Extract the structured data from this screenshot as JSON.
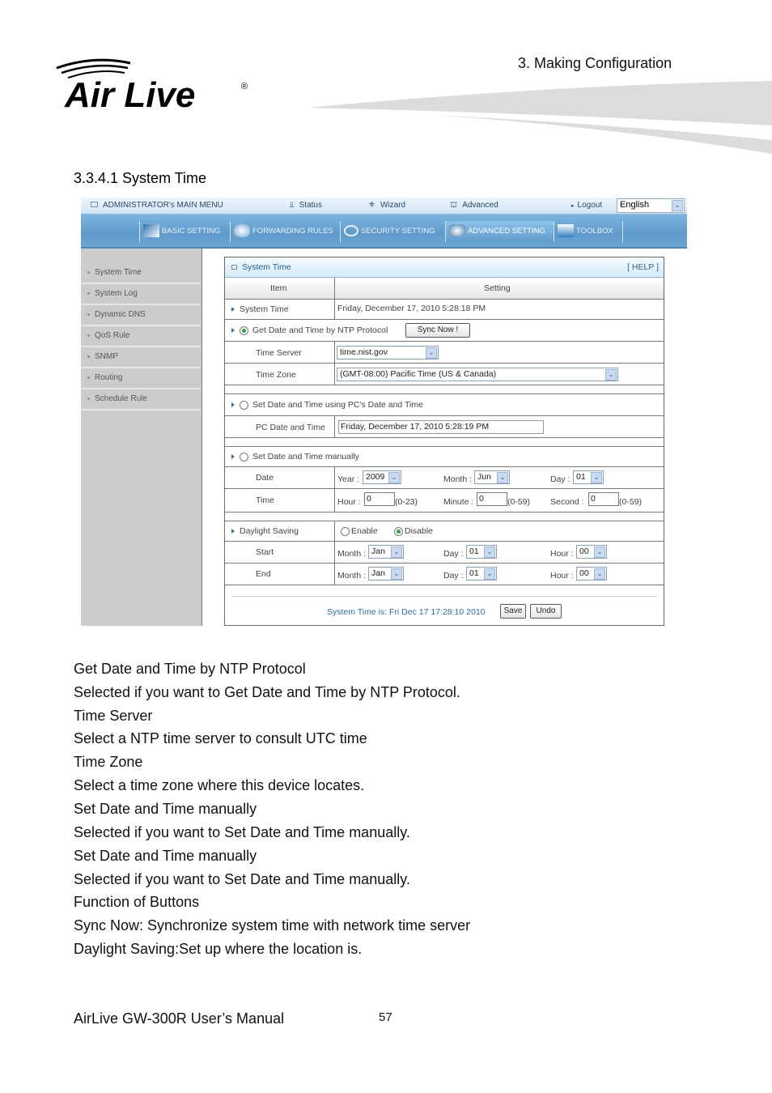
{
  "header": {
    "logo_text": "Air Live",
    "logo_mark": "®",
    "chapter": "3.  Making  Configuration"
  },
  "section_title": "3.3.4.1 System Time",
  "ui": {
    "topbar": {
      "main_menu": "ADMINISTRATOR's MAIN MENU",
      "status": "Status",
      "wizard": "Wizard",
      "advanced": "Advanced",
      "logout": "Logout",
      "language": "English"
    },
    "nav_tabs": [
      {
        "label": "BASIC SETTING",
        "icon": "basic-setting-icon"
      },
      {
        "label": "FORWARDING RULES",
        "icon": "forwarding-rules-icon"
      },
      {
        "label": "SECURITY SETTING",
        "icon": "security-setting-icon"
      },
      {
        "label": "ADVANCED SETTING",
        "icon": "advanced-setting-icon",
        "active": true
      },
      {
        "label": "TOOLBOX",
        "icon": "toolbox-icon"
      }
    ],
    "sidebar": [
      {
        "label": "System Time"
      },
      {
        "label": "System Log"
      },
      {
        "label": "Dynamic DNS"
      },
      {
        "label": "QoS Rule"
      },
      {
        "label": "SNMP"
      },
      {
        "label": "Routing"
      },
      {
        "label": "Schedule Rule"
      }
    ],
    "panel": {
      "title": "System Time",
      "help": "[ HELP ]",
      "col_item": "Item",
      "col_setting": "Setting",
      "system_time_label": "System Time",
      "system_time_value": "Friday, December 17, 2010 5:28:18 PM",
      "ntp_label": "Get Date and Time by NTP Protocol",
      "sync_now": "Sync Now !",
      "time_server_label": "Time Server",
      "time_server_value": "time.nist.gov",
      "time_zone_label": "Time Zone",
      "time_zone_value": "(GMT-08:00) Pacific Time (US & Canada)",
      "pc_label": "Set Date and Time using PC's Date and Time",
      "pc_date_label": "PC Date and Time",
      "pc_date_value": "Friday, December 17, 2010 5:28:19 PM",
      "manual_label": "Set Date and Time manually",
      "date_label": "Date",
      "year_label": "Year :",
      "year_value": "2009",
      "month_label": "Month :",
      "month_value": "Jun",
      "day_label": "Day :",
      "day_value": "01",
      "time_label": "Time",
      "hour_label": "Hour :",
      "hour_value": "0",
      "hour_range": "(0-23)",
      "minute_label": "Minute :",
      "minute_value": "0",
      "minute_range": "(0-59)",
      "second_label": "Second :",
      "second_value": "0",
      "second_range": "(0-59)",
      "dst_label": "Daylight Saving",
      "dst_enable": "Enable",
      "dst_disable": "Disable",
      "start_label": "Start",
      "end_label": "End",
      "dst_month_label": "Month :",
      "dst_day_label": "Day :",
      "dst_hour_label": "Hour :",
      "start_month": "Jan",
      "start_day": "01",
      "start_hour": "00",
      "end_month": "Jan",
      "end_day": "01",
      "end_hour": "00",
      "status_text": "System Time is: Fri Dec 17 17:28:10 2010",
      "save": "Save",
      "undo": "Undo"
    }
  },
  "body_lines": [
    "Get Date and Time by NTP Protocol",
    "Selected if you want to Get Date and Time by NTP Protocol.",
    "Time Server",
    "Select a NTP time server to consult UTC time",
    "Time Zone",
    "Select a time zone where this device locates.",
    "Set Date and Time manually",
    "Selected if you want to Set Date and Time manually.",
    "Set Date and Time manually",
    "Selected if you want to Set Date and Time manually.",
    "Function of Buttons",
    "Sync Now: Synchronize system time with network time server",
    "Daylight Saving:Set up where the location is."
  ],
  "footer": {
    "manual": "AirLive GW-300R User’s Manual",
    "page": "57"
  }
}
